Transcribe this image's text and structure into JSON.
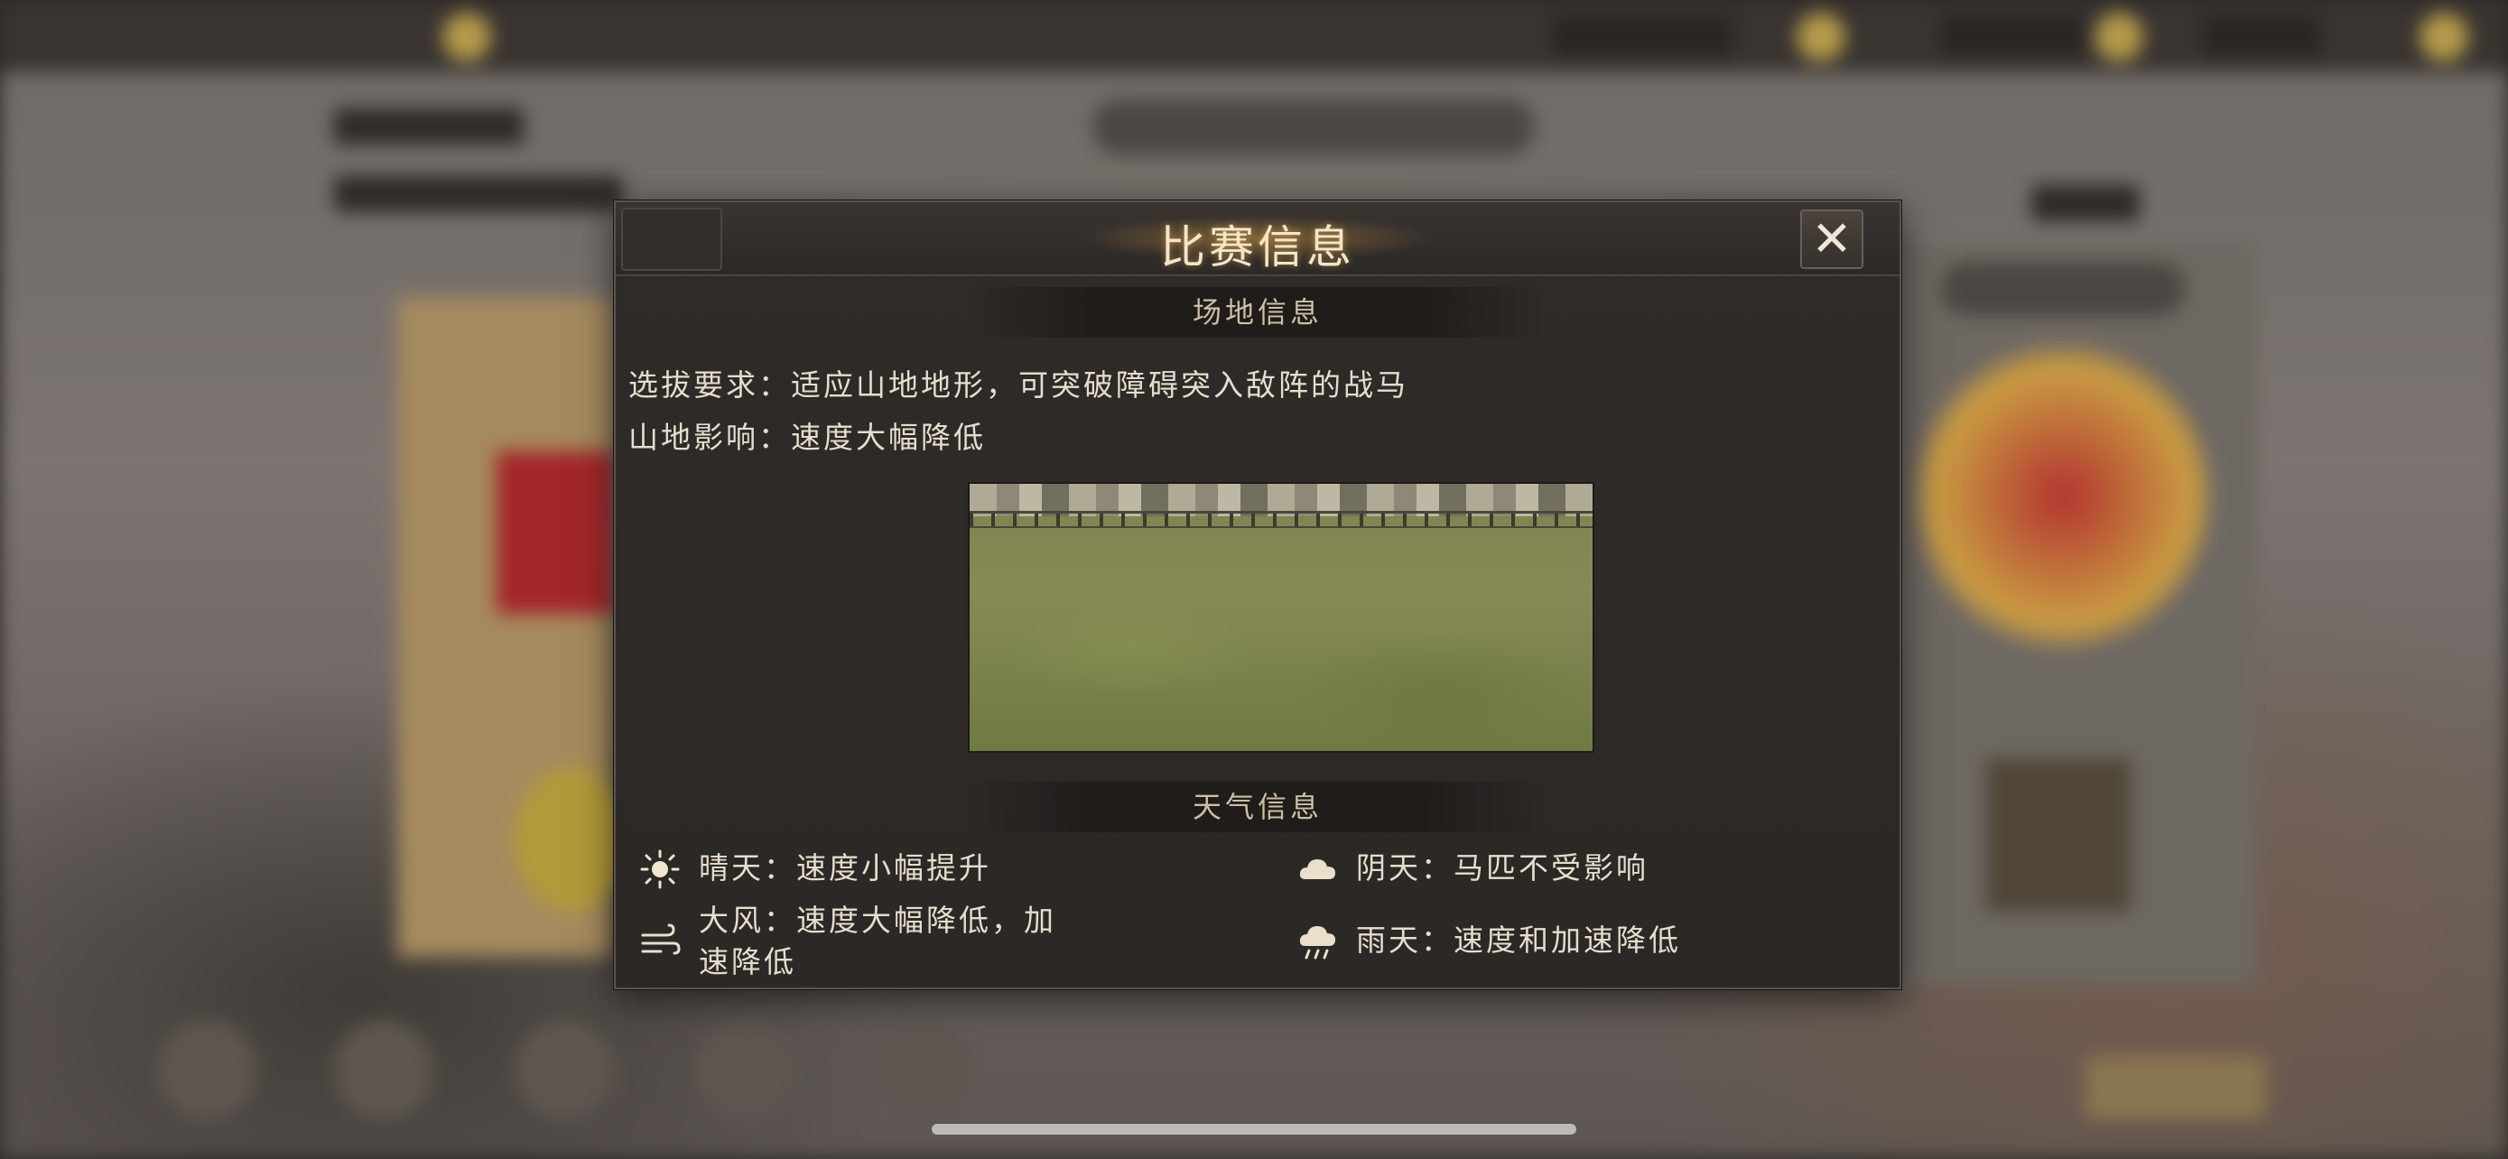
{
  "dialog": {
    "title": "比赛信息",
    "close_symbol": "✕"
  },
  "venue": {
    "header": "场地信息",
    "requirement_label": "选拔要求：",
    "requirement_value": "适应山地地形，可突破障碍突入敌阵的战马",
    "effect_label": "山地影响：",
    "effect_value": "速度大幅降低",
    "image_alt": "山地赛场"
  },
  "weather": {
    "header": "天气信息",
    "items": [
      {
        "icon": "sun-icon",
        "line1": "晴天：速度小幅提升",
        "line2": ""
      },
      {
        "icon": "cloud-icon",
        "line1": "阴天：马匹不受影响",
        "line2": ""
      },
      {
        "icon": "wind-icon",
        "line1": "大风：速度大幅降低，加",
        "line2": "速降低"
      },
      {
        "icon": "rain-icon",
        "line1": "雨天：速度和加速降低",
        "line2": ""
      }
    ]
  },
  "colors": {
    "accent_gold": "#f3e6c8",
    "text": "#e6ddcd",
    "panel_bg": "#2b2826"
  }
}
